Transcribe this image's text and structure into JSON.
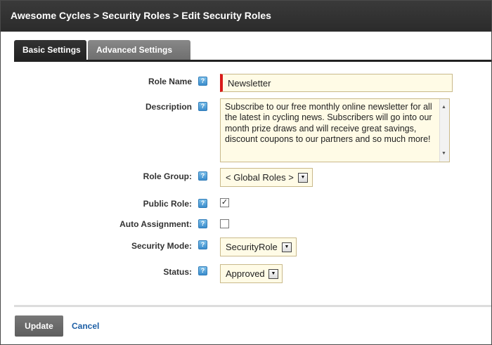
{
  "header": {
    "breadcrumb": "Awesome Cycles > Security Roles > Edit Security Roles"
  },
  "tabs": [
    {
      "label": "Basic Settings",
      "active": true
    },
    {
      "label": "Advanced Settings",
      "active": false
    }
  ],
  "form": {
    "role_name": {
      "label": "Role Name",
      "value": "Newsletter",
      "help_icon": "help-icon"
    },
    "description": {
      "label": "Description",
      "value": "Subscribe to our free monthly online newsletter for all the latest in cycling news. Subscribers will go into our month prize draws and will receive great savings, discount coupons to our partners and so much more!"
    },
    "role_group": {
      "label": "Role Group:",
      "value": "< Global Roles >"
    },
    "public_role": {
      "label": "Public Role:",
      "checked": true,
      "check_glyph": "✓"
    },
    "auto_assignment": {
      "label": "Auto Assignment:",
      "checked": false,
      "check_glyph": ""
    },
    "security_mode": {
      "label": "Security Mode:",
      "value": "SecurityRole"
    },
    "status": {
      "label": "Status:",
      "value": "Approved"
    }
  },
  "actions": {
    "update_label": "Update",
    "cancel_label": "Cancel"
  },
  "colors": {
    "titlebar": "#2f2f2f",
    "field_bg": "#fffbe6",
    "required_marker": "#d91a1a",
    "link": "#1d5fa6",
    "help_icon": "#4a9ad6"
  }
}
